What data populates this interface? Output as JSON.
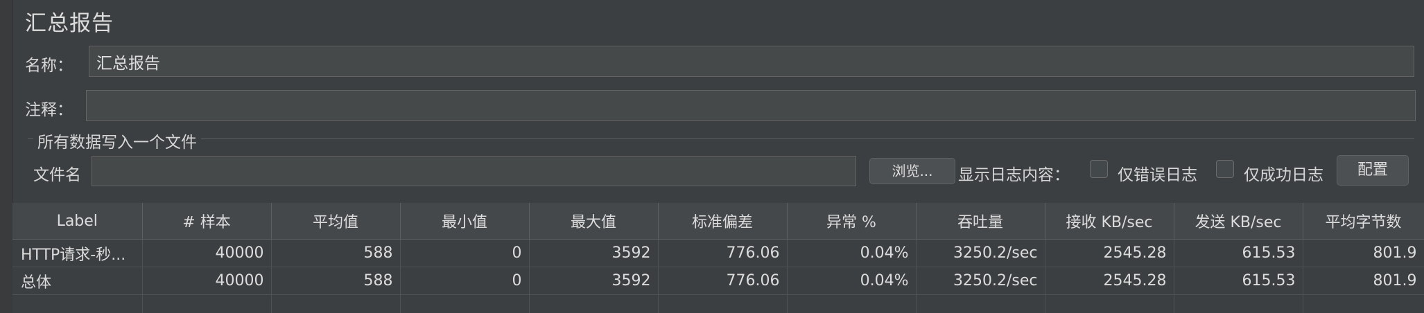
{
  "panel": {
    "title": "汇总报告"
  },
  "form": {
    "name_label": "名称：",
    "name_value": "汇总报告",
    "comment_label": "注释：",
    "comment_value": ""
  },
  "file_section": {
    "title": "所有数据写入一个文件",
    "filename_label": "文件名",
    "filename_value": "",
    "browse_label": "浏览...",
    "log_label": "显示日志内容：",
    "errors_only_label": "仅错误日志",
    "errors_only_checked": false,
    "success_only_label": "仅成功日志",
    "success_only_checked": false,
    "configure_label": "配置"
  },
  "table": {
    "columns": [
      "Label",
      "# 样本",
      "平均值",
      "最小值",
      "最大值",
      "标准偏差",
      "异常 %",
      "吞吐量",
      "接收 KB/sec",
      "发送 KB/sec",
      "平均字节数"
    ],
    "rows": [
      [
        "HTTP请求-秒...",
        "40000",
        "588",
        "0",
        "3592",
        "776.06",
        "0.04%",
        "3250.2/sec",
        "2545.28",
        "615.53",
        "801.9"
      ],
      [
        "总体",
        "40000",
        "588",
        "0",
        "3592",
        "776.06",
        "0.04%",
        "3250.2/sec",
        "2545.28",
        "615.53",
        "801.9"
      ]
    ]
  }
}
